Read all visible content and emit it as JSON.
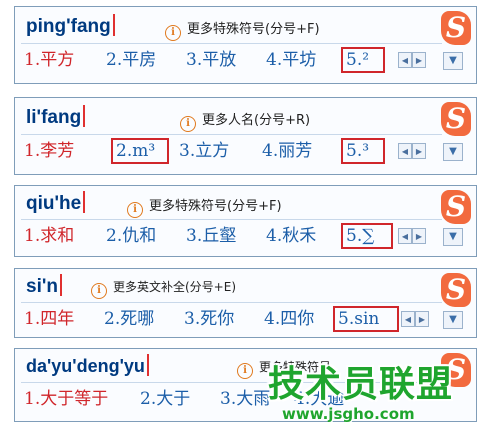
{
  "panels": [
    {
      "pinyin": "ping'fang",
      "hint": "更多特殊符号(分号+F)",
      "candidates": [
        "1.平方",
        "2.平房",
        "3.平放",
        "4.平坊",
        "5.²"
      ]
    },
    {
      "pinyin": "li'fang",
      "hint": "更多人名(分号+R)",
      "candidates": [
        "1.李芳",
        "2.m³",
        "3.立方",
        "4.丽芳",
        "5.³"
      ]
    },
    {
      "pinyin": "qiu'he",
      "hint": "更多特殊符号(分号+F)",
      "candidates": [
        "1.求和",
        "2.仇和",
        "3.丘壑",
        "4.秋禾",
        "5.∑"
      ]
    },
    {
      "pinyin": "si'n",
      "hint": "更多英文补全(分号+E)",
      "candidates": [
        "1.四年",
        "2.死哪",
        "3.死你",
        "4.四你",
        "5.sin"
      ]
    },
    {
      "pinyin": "da'yu'deng'yu",
      "hint": "更多特殊符号",
      "candidates": [
        "1.大于等于",
        "2.大于",
        "3.大雨",
        "4.大逾"
      ]
    }
  ],
  "icons": {
    "info": "i",
    "logo": "S",
    "prev": "◀",
    "next": "▶",
    "menu": "▼"
  },
  "watermark": {
    "title": "技术员联盟",
    "url": "www.jsgho.com"
  },
  "colors": {
    "pinyin": "#003a80",
    "first_candidate": "#d0262b",
    "candidate": "#1c5ea8",
    "highlight_border": "#d0262b",
    "logo": "#f26a3e",
    "watermark": "#1fa52e"
  }
}
